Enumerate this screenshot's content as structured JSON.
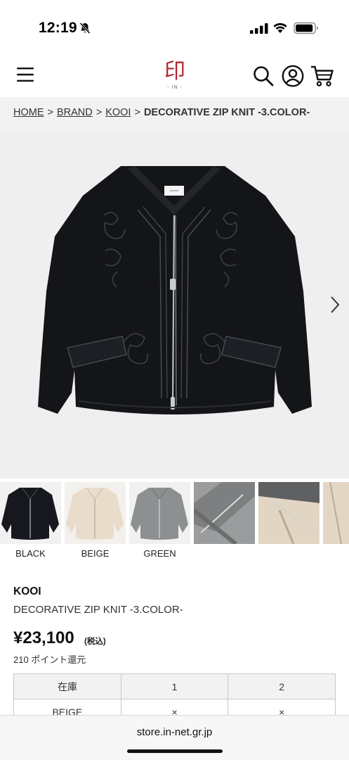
{
  "status_bar": {
    "time": "12:19"
  },
  "header": {
    "logo_text": "印",
    "logo_sub": "- IN -"
  },
  "breadcrumb": {
    "items": [
      "HOME",
      "BRAND",
      "KOOI"
    ],
    "separator": ">",
    "current": "DECORATIVE ZIP KNIT -3.COLOR-"
  },
  "thumbnails": [
    {
      "label": "BLACK",
      "color": "#16181d"
    },
    {
      "label": "BEIGE",
      "color": "#e9dccb"
    },
    {
      "label": "GREEN",
      "color": "#8d9090"
    },
    {
      "label": "",
      "color": "#7d7f80"
    },
    {
      "label": "",
      "color": "#cbbfae"
    },
    {
      "label": "",
      "color": "#e4d6c4"
    }
  ],
  "product": {
    "brand": "KOOI",
    "name": "DECORATIVE ZIP KNIT -3.COLOR-",
    "price": "¥23,100",
    "tax_note": "(税込)",
    "points": "210 ポイント還元"
  },
  "stock_table": {
    "header": [
      "在庫",
      "1",
      "2"
    ],
    "rows": [
      [
        "BEIGE",
        "×",
        "×"
      ]
    ]
  },
  "browser": {
    "url": "store.in-net.gr.jp"
  },
  "colors": {
    "garment": "#141519",
    "stitch": "#4a4c54",
    "zipper": "#b9bcc2",
    "breadcrumb_bg": "#f2f2f2",
    "logo_red": "#b3262b"
  }
}
